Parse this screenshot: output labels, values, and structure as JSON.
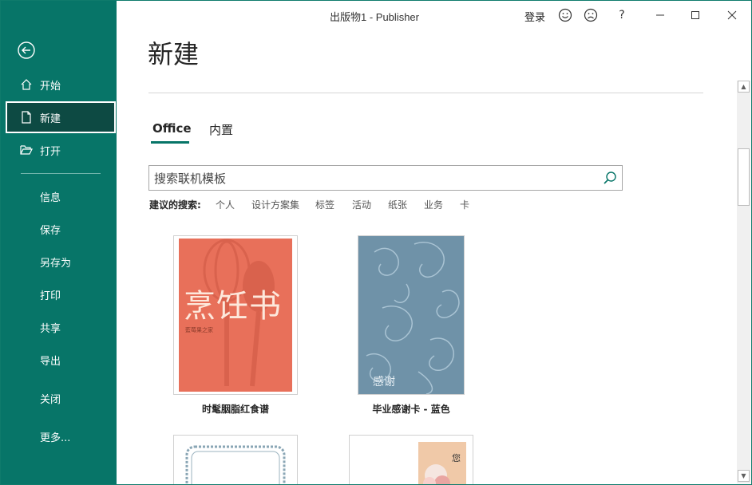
{
  "window": {
    "title": "出版物1  -  Publisher",
    "signin": "登录",
    "help": "?"
  },
  "sidebar": {
    "items": [
      {
        "label": "开始"
      },
      {
        "label": "新建"
      },
      {
        "label": "打开"
      }
    ],
    "plain": [
      {
        "label": "信息"
      },
      {
        "label": "保存"
      },
      {
        "label": "另存为"
      },
      {
        "label": "打印"
      },
      {
        "label": "共享"
      },
      {
        "label": "导出"
      },
      {
        "label": "关闭"
      },
      {
        "label": "更多..."
      }
    ]
  },
  "main": {
    "heading": "新建",
    "tabs": [
      {
        "label": "Office"
      },
      {
        "label": "内置"
      }
    ],
    "search": {
      "placeholder": "搜索联机模板"
    },
    "suggest_label": "建议的搜索:",
    "suggestions": [
      "个人",
      "设计方案集",
      "标签",
      "活动",
      "纸张",
      "业务",
      "卡"
    ],
    "templates": [
      {
        "name": "时髦胭脂红食谱",
        "cover_title": "烹饪书",
        "cover_subtitle": "藍莓果之家",
        "color": "#e8705a"
      },
      {
        "name": "毕业感谢卡 - 蓝色",
        "cover_title": "感谢",
        "color": "#6f92a8"
      },
      {
        "name": "",
        "cover_title": ""
      },
      {
        "name": "",
        "cover_title": "您"
      }
    ]
  },
  "colors": {
    "accent": "#077568",
    "sidebar_active": "#0d4a43"
  }
}
